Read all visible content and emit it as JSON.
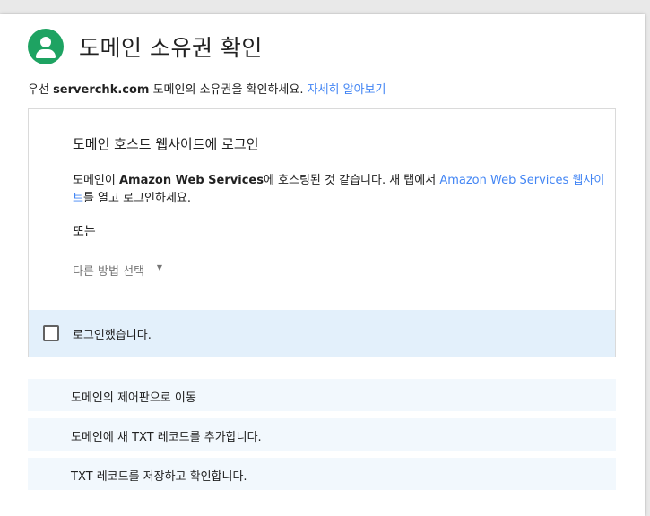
{
  "header": {
    "title": "도메인 소유권 확인",
    "icon": "person-icon",
    "icon_color": "#1ea362"
  },
  "intro": {
    "prefix": "우선 ",
    "domain": "serverchk.com",
    "suffix": " 도메인의 소유권을 확인하세요. ",
    "link": "자세히 알아보기"
  },
  "panel": {
    "title": "도메인 호스트 웹사이트에 로그인",
    "desc_prefix": "도메인이 ",
    "provider": "Amazon Web Services",
    "desc_mid": "에 호스팅된 것 같습니다. 새 탭에서 ",
    "provider_link": "Amazon Web Services 웹사이트",
    "desc_suffix": "를 열고 로그인하세요.",
    "or_text": "또는",
    "select_label": "다른 방법 선택",
    "checkbox_label": "로그인했습니다.",
    "checkbox_checked": false
  },
  "steps": [
    "도메인의 제어판으로 이동",
    "도메인에 새 TXT 레코드를 추가합니다.",
    "TXT 레코드를 저장하고 확인합니다."
  ],
  "colors": {
    "link": "#4285f4",
    "highlight": "#e3f0fb"
  }
}
